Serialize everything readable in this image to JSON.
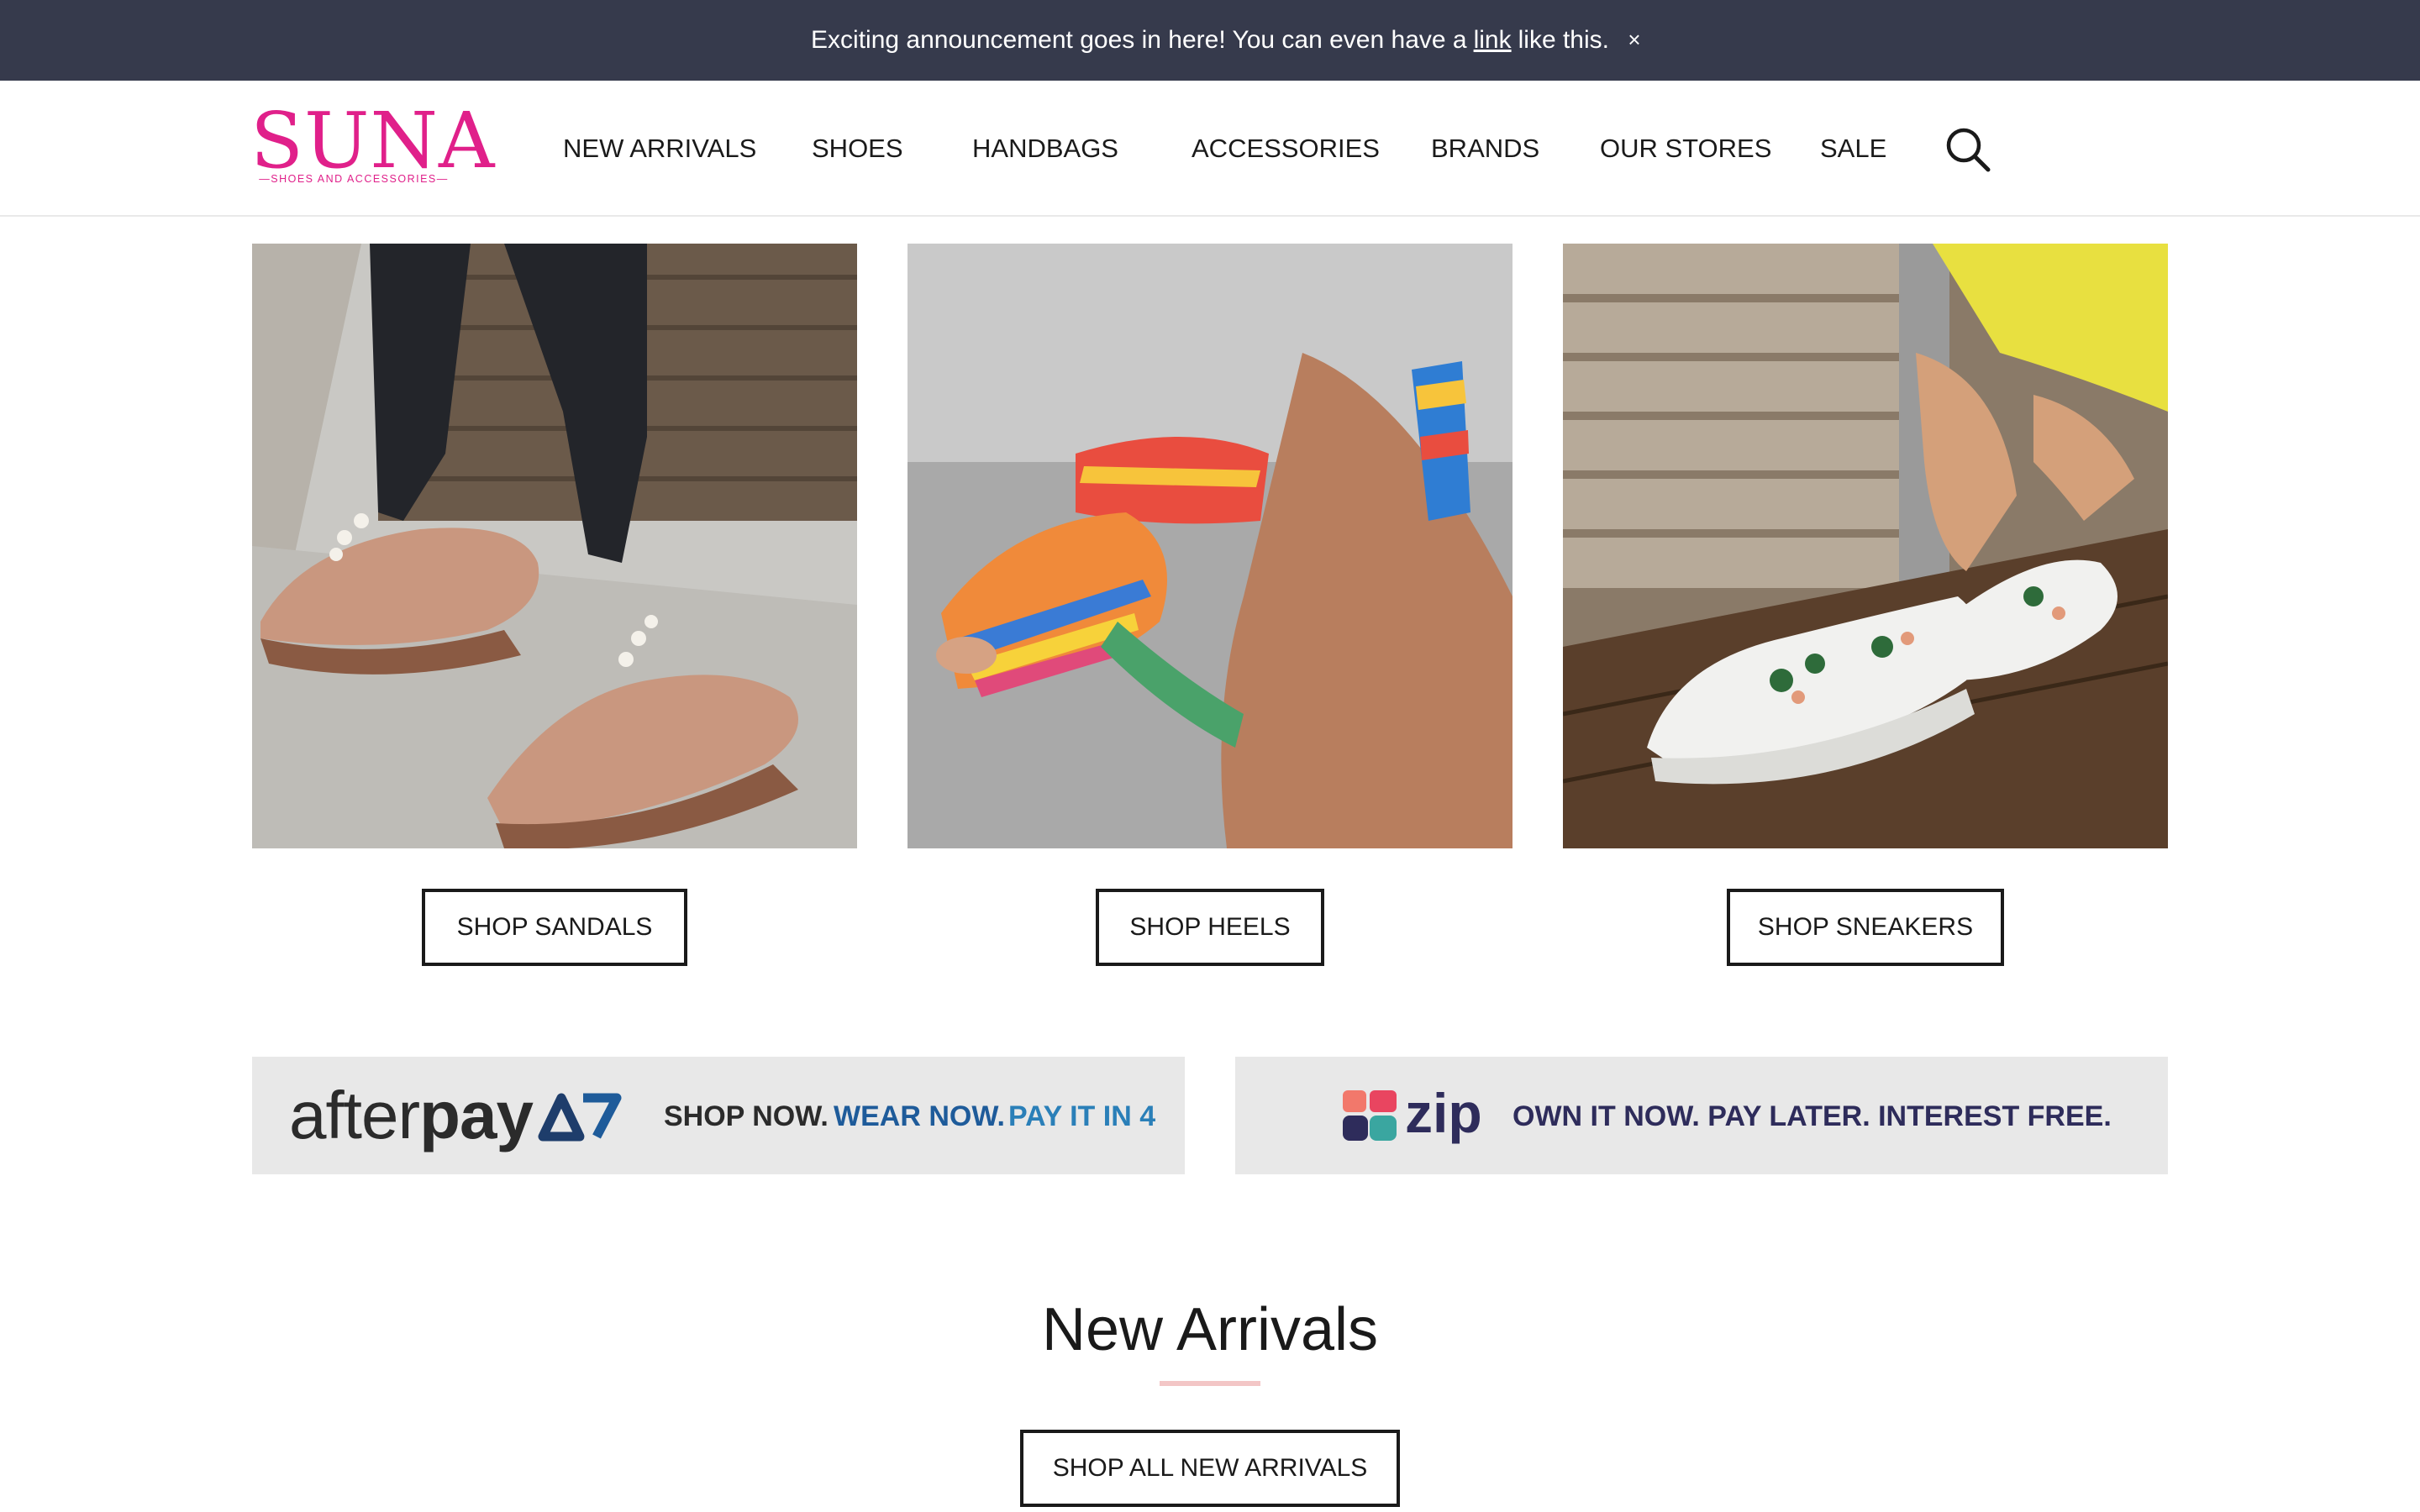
{
  "announcement": {
    "text_before": "Exciting announcement goes in here! You can even have a",
    "link_label": "link",
    "text_after": "like this.",
    "close_label": "×"
  },
  "brand": {
    "name": "SUNA",
    "tagline": "—SHOES AND ACCESSORIES—",
    "color": "#e0208a"
  },
  "nav": {
    "items": [
      {
        "label": "NEW ARRIVALS"
      },
      {
        "label": "SHOES"
      },
      {
        "label": "HANDBAGS"
      },
      {
        "label": "ACCESSORIES"
      },
      {
        "label": "BRANDS"
      },
      {
        "label": "OUR STORES"
      },
      {
        "label": "SALE"
      }
    ],
    "search_icon": "search-icon"
  },
  "categories": [
    {
      "button": "SHOP SANDALS"
    },
    {
      "button": "SHOP HEELS"
    },
    {
      "button": "SHOP SNEAKERS"
    }
  ],
  "payments": {
    "afterpay": {
      "logo_light": "after",
      "logo_bold": "pay",
      "text_1": "SHOP NOW.",
      "text_2": "WEAR NOW.",
      "text_3": "PAY IT IN 4",
      "colors": {
        "dark": "#2b2b2b",
        "blue": "#1e5b9a",
        "teal": "#2a7fb8"
      }
    },
    "zip": {
      "logo": "zip",
      "text": "OWN IT NOW. PAY LATER. INTEREST FREE.",
      "color": "#2e2c5b"
    }
  },
  "new_arrivals": {
    "title": "New Arrivals",
    "button": "SHOP ALL NEW ARRIVALS"
  },
  "colors": {
    "announcement_bg": "#363a4c",
    "title_underline": "#f3c6c6"
  }
}
